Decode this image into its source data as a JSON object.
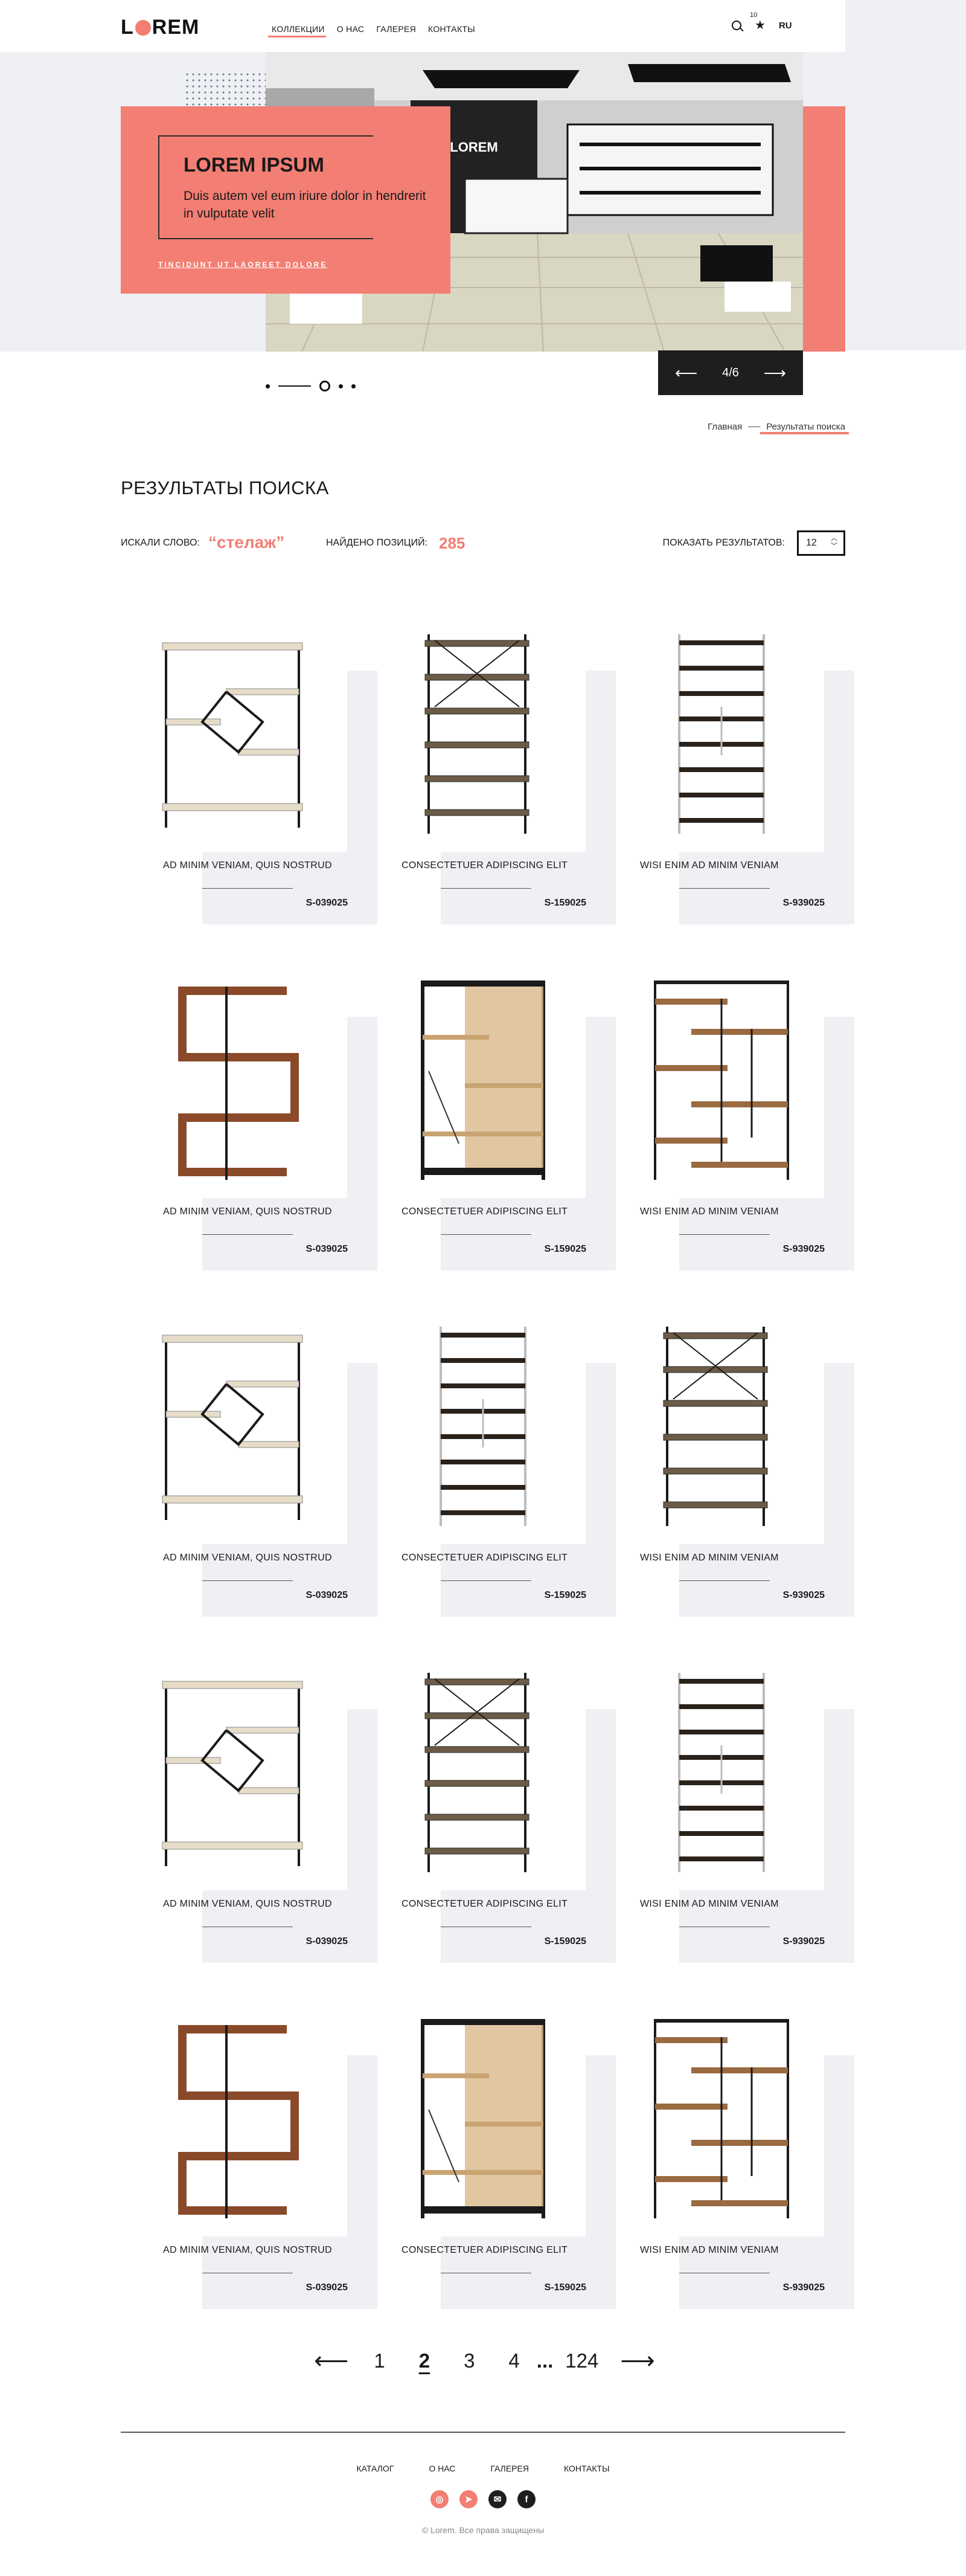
{
  "header": {
    "logo": "LOREM",
    "nav": [
      "КОЛЛЕКЦИИ",
      "О НАС",
      "ГАЛЕРЕЯ",
      "КОНТАКТЫ"
    ],
    "favorites_count": "10",
    "language": "RU",
    "icons": [
      "search-icon",
      "star-icon"
    ]
  },
  "hero": {
    "title": "LOREM IPSUM",
    "text": "Duis autem vel eum iriure dolor in hendrerit in vulputate velit",
    "cta": "TINCIDUNT UT LAOREET DOLORE",
    "sign": "LOREM",
    "slide_counter": "4/6",
    "prev_arrow": "⟵",
    "next_arrow": "⟶"
  },
  "breadcrumb": {
    "home": "Главная",
    "current": "Результаты поиска"
  },
  "page_title": "РЕЗУЛЬТАТЫ ПОИСКА",
  "search_meta": {
    "searched_label": "ИСКАЛИ СЛОВО:",
    "keyword": "“стелаж”",
    "found_label": "НАЙДЕНО ПОЗИЦИЙ:",
    "found_count": "285",
    "show_label": "ПОКАЗАТЬ  РЕЗУЛЬТАТОВ:",
    "per_page": "12"
  },
  "products": [
    {
      "name": "AD MINIM VENIAM, QUIS NOSTRUD",
      "sku": "S-039025",
      "icon": "hex-shelf-image"
    },
    {
      "name": "CONSECTETUER ADIPISCING ELIT",
      "sku": "S-159025",
      "icon": "metal-shelf-image"
    },
    {
      "name": "WISI ENIM AD MINIM VENIAM",
      "sku": "S-939025",
      "icon": "tall-shelf-image"
    },
    {
      "name": "AD MINIM VENIAM, QUIS NOSTRUD",
      "sku": "S-039025",
      "icon": "wood-zigzag-shelf-image"
    },
    {
      "name": "CONSECTETUER ADIPISCING ELIT",
      "sku": "S-159025",
      "icon": "stair-shelf-image"
    },
    {
      "name": "WISI ENIM AD MINIM VENIAM",
      "sku": "S-939025",
      "icon": "wood-grid-shelf-image"
    },
    {
      "name": "AD MINIM VENIAM, QUIS NOSTRUD",
      "sku": "S-039025",
      "icon": "hex-shelf-image"
    },
    {
      "name": "CONSECTETUER ADIPISCING ELIT",
      "sku": "S-159025",
      "icon": "tall-shelf-image"
    },
    {
      "name": "WISI ENIM AD MINIM VENIAM",
      "sku": "S-939025",
      "icon": "metal-shelf-image"
    },
    {
      "name": "AD MINIM VENIAM, QUIS NOSTRUD",
      "sku": "S-039025",
      "icon": "hex-shelf-image"
    },
    {
      "name": "CONSECTETUER ADIPISCING ELIT",
      "sku": "S-159025",
      "icon": "metal-shelf-image"
    },
    {
      "name": "WISI ENIM AD MINIM VENIAM",
      "sku": "S-939025",
      "icon": "tall-shelf-image"
    },
    {
      "name": "AD MINIM VENIAM, QUIS NOSTRUD",
      "sku": "S-039025",
      "icon": "wood-zigzag-shelf-image"
    },
    {
      "name": "CONSECTETUER ADIPISCING ELIT",
      "sku": "S-159025",
      "icon": "stair-shelf-image"
    },
    {
      "name": "WISI ENIM AD MINIM VENIAM",
      "sku": "S-939025",
      "icon": "wood-grid-shelf-image"
    }
  ],
  "pagination": {
    "prev": "⟵",
    "pages": [
      "1",
      "2",
      "3",
      "4"
    ],
    "current": "2",
    "ellipsis": "...",
    "last": "124",
    "next": "⟶"
  },
  "footer": {
    "nav": [
      "КАТАЛОГ",
      "О НАС",
      "ГАЛЕРЕЯ",
      "КОНТАКТЫ"
    ],
    "socials": [
      "instagram-icon",
      "telegram-icon",
      "mail-icon",
      "facebook-icon"
    ],
    "copyright": "© Lorem. Все права защищены"
  },
  "colors": {
    "accent": "#f37e73",
    "panel": "#eff0f4",
    "dark": "#1e1e1e"
  }
}
